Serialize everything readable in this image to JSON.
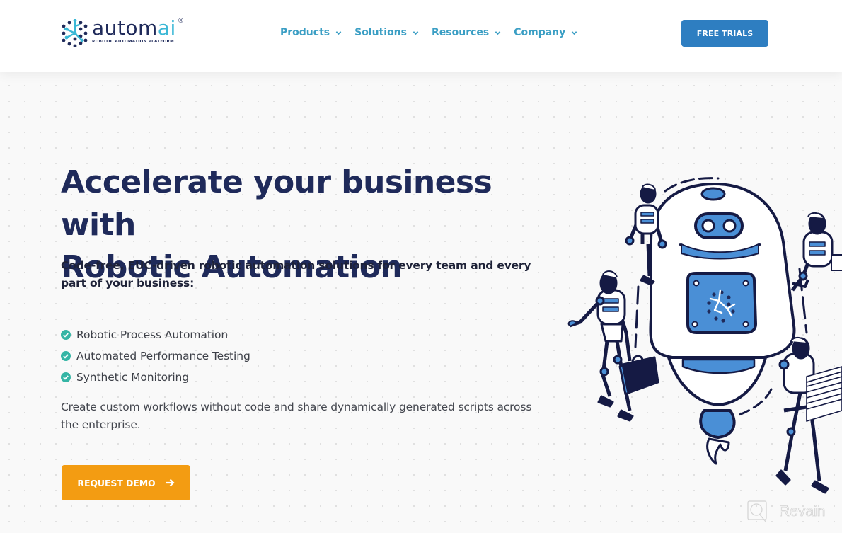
{
  "header": {
    "logo": {
      "wordmark_main": "autom",
      "wordmark_accent": "ai",
      "registered": "®",
      "tagline": "ROBOTIC AUTOMATION PLATFORM",
      "icon": "network-dots-icon"
    },
    "nav": [
      {
        "label": "Products",
        "icon": "chevron-down-icon"
      },
      {
        "label": "Solutions",
        "icon": "chevron-down-icon"
      },
      {
        "label": "Resources",
        "icon": "chevron-down-icon"
      },
      {
        "label": "Company",
        "icon": "chevron-down-icon"
      }
    ],
    "cta_label": "FREE TRIALS"
  },
  "hero": {
    "title_line1": "Accelerate your business with",
    "title_line2": "Robotic Automation",
    "subtitle": "Code-free, EUC-driven robotic automation solutions for every team and every part of your business:",
    "features": [
      {
        "label": "Robotic Process Automation",
        "icon": "check-circle-icon"
      },
      {
        "label": "Automated Performance Testing",
        "icon": "check-circle-icon"
      },
      {
        "label": "Synthetic Monitoring",
        "icon": "check-circle-icon"
      }
    ],
    "description": "Create custom workflows without code and share dynamically generated scripts across the enterprise.",
    "cta_label": "REQUEST DEMO",
    "cta_icon": "arrow-right-icon",
    "illustration": "robots-illustration"
  },
  "watermark": {
    "text": "Revain",
    "icon": "revain-logo-icon"
  },
  "colors": {
    "navy": "#1f2a5a",
    "nav_teal": "#3a9ec4",
    "trial_blue": "#2e7ec1",
    "demo_orange": "#f39c12",
    "check_teal": "#35b5a5",
    "robot_blue": "#4a8fd6",
    "robot_dark": "#151a44"
  }
}
